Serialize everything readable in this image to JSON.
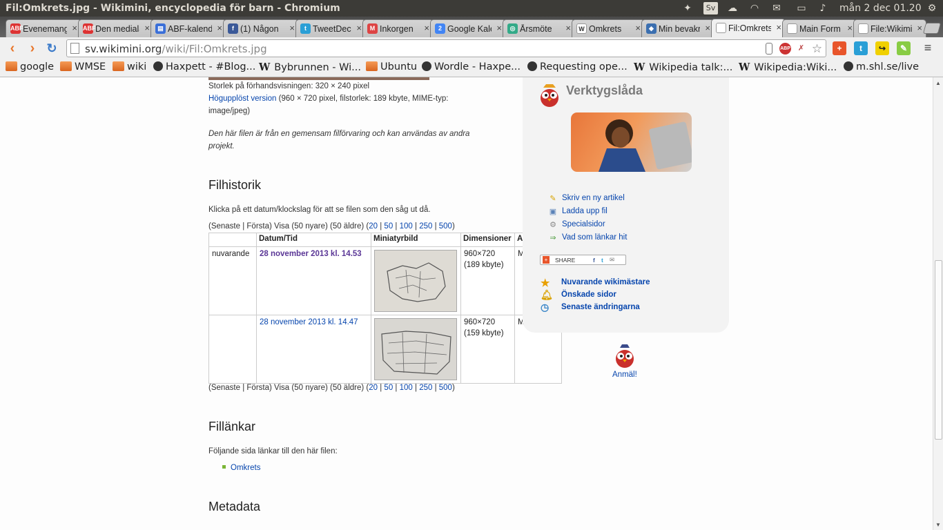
{
  "window": {
    "title": "Fil:Omkrets.jpg - Wikimini, encyclopedia för barn - Chromium"
  },
  "tray": {
    "keyboard": "Sv",
    "clock": "mån 2 dec  01.20",
    "icons": [
      "dropbox-icon",
      "keyboard-layout-icon",
      "cloud-icon",
      "wifi-icon",
      "mail-icon",
      "battery-icon",
      "volume-icon",
      "settings-gear-icon"
    ]
  },
  "tabs": [
    {
      "label": "Evenemang",
      "fav": "ABF",
      "color": "#d33"
    },
    {
      "label": "Den mediala",
      "fav": "ABF",
      "color": "#d33"
    },
    {
      "label": "ABF-kalender",
      "fav": "▤",
      "color": "#3a6fd8"
    },
    {
      "label": "(1) Någon",
      "fav": "f",
      "color": "#3b5998"
    },
    {
      "label": "TweetDeck",
      "fav": "t",
      "color": "#2a9fd6"
    },
    {
      "label": "Inkorgen",
      "fav": "M",
      "color": "#d44"
    },
    {
      "label": "Google Kalender",
      "fav": "2",
      "color": "#4285f4"
    },
    {
      "label": "Årsmöte",
      "fav": "◎",
      "color": "#3a8"
    },
    {
      "label": "Omkrets",
      "fav": "W",
      "color": "#fff"
    },
    {
      "label": "Min bevakning",
      "fav": "◆",
      "color": "#3b6fb0"
    },
    {
      "label": "Fil:Omkrets",
      "fav": "",
      "color": "#fff"
    },
    {
      "label": "Main Form",
      "fav": "",
      "color": "#fff"
    },
    {
      "label": "File:Wikimini",
      "fav": "",
      "color": "#fff"
    }
  ],
  "toolbar": {
    "url_host": "sv.wikimini.org",
    "url_path": "/wiki/Fil:Omkrets.jpg"
  },
  "bookmarks": [
    {
      "label": "google",
      "type": "folder"
    },
    {
      "label": "WMSE",
      "type": "folder"
    },
    {
      "label": "wiki",
      "type": "folder"
    },
    {
      "label": "Haxpett - #Blog...",
      "type": "site"
    },
    {
      "label": "Bybrunnen - Wi...",
      "type": "wiki"
    },
    {
      "label": "Ubuntu",
      "type": "folder"
    },
    {
      "label": "Wordle - Haxpe...",
      "type": "site"
    },
    {
      "label": "Requesting ope...",
      "type": "site"
    },
    {
      "label": "Wikipedia talk:...",
      "type": "wiki"
    },
    {
      "label": "Wikipedia:Wiki...",
      "type": "wiki"
    },
    {
      "label": "m.shl.se/live",
      "type": "site"
    }
  ],
  "file": {
    "preview_size": "Storlek på förhandsvisningen: 320 × 240 pixel",
    "hires_link": "Högupplöst version",
    "hires_info": "(960 × 720 pixel, filstorlek: 189 kbyte, MIME-typ:",
    "hires_info2": "image/jpeg)",
    "commons_note1": "Den här filen är från en gemensam filförvaring och kan användas av andra",
    "commons_note2": "projekt."
  },
  "history": {
    "heading": "Filhistorik",
    "intro": "Klicka på ett datum/klockslag för att se filen som den såg ut då.",
    "pager_prefix": "(Senaste | Första) Visa (50 nyare) (50 äldre) (",
    "pager_options": [
      "20",
      "50",
      "100",
      "250",
      "500"
    ],
    "pager_sep": " | ",
    "pager_suffix": ")",
    "columns": [
      "",
      "Datum/Tid",
      "Miniatyrbild",
      "Dimensioner",
      "A"
    ],
    "rows": [
      {
        "status": "nuvarande",
        "date": "28 november 2013 kl. 14.53",
        "dims": "960×720",
        "size": "(189 kbyte)",
        "user": "M"
      },
      {
        "status": "",
        "date": "28 november 2013 kl. 14.47",
        "dims": "960×720",
        "size": "(159 kbyte)",
        "user": "M"
      }
    ]
  },
  "filelinks": {
    "heading": "Fillänkar",
    "intro": "Följande sida länkar till den här filen:",
    "items": [
      "Omkrets"
    ]
  },
  "metadata": {
    "heading": "Metadata"
  },
  "toolbox": {
    "title": "Verktygslåda",
    "links": [
      {
        "label": "Skriv en ny artikel",
        "icon": "pencil-icon"
      },
      {
        "label": "Ladda upp fil",
        "icon": "upload-image-icon"
      },
      {
        "label": "Specialsidor",
        "icon": "gear-icon"
      },
      {
        "label": "Vad som länkar hit",
        "icon": "arrow-link-icon"
      }
    ],
    "share_label": "SHARE",
    "bold_links": [
      {
        "label": "Nuvarande wikimästare",
        "icon": "star-icon"
      },
      {
        "label": "Önskade sidor",
        "icon": "bell-icon"
      },
      {
        "label": "Senaste ändringarna",
        "icon": "clock-icon"
      }
    ]
  },
  "report": {
    "label": "Anmäl!"
  }
}
